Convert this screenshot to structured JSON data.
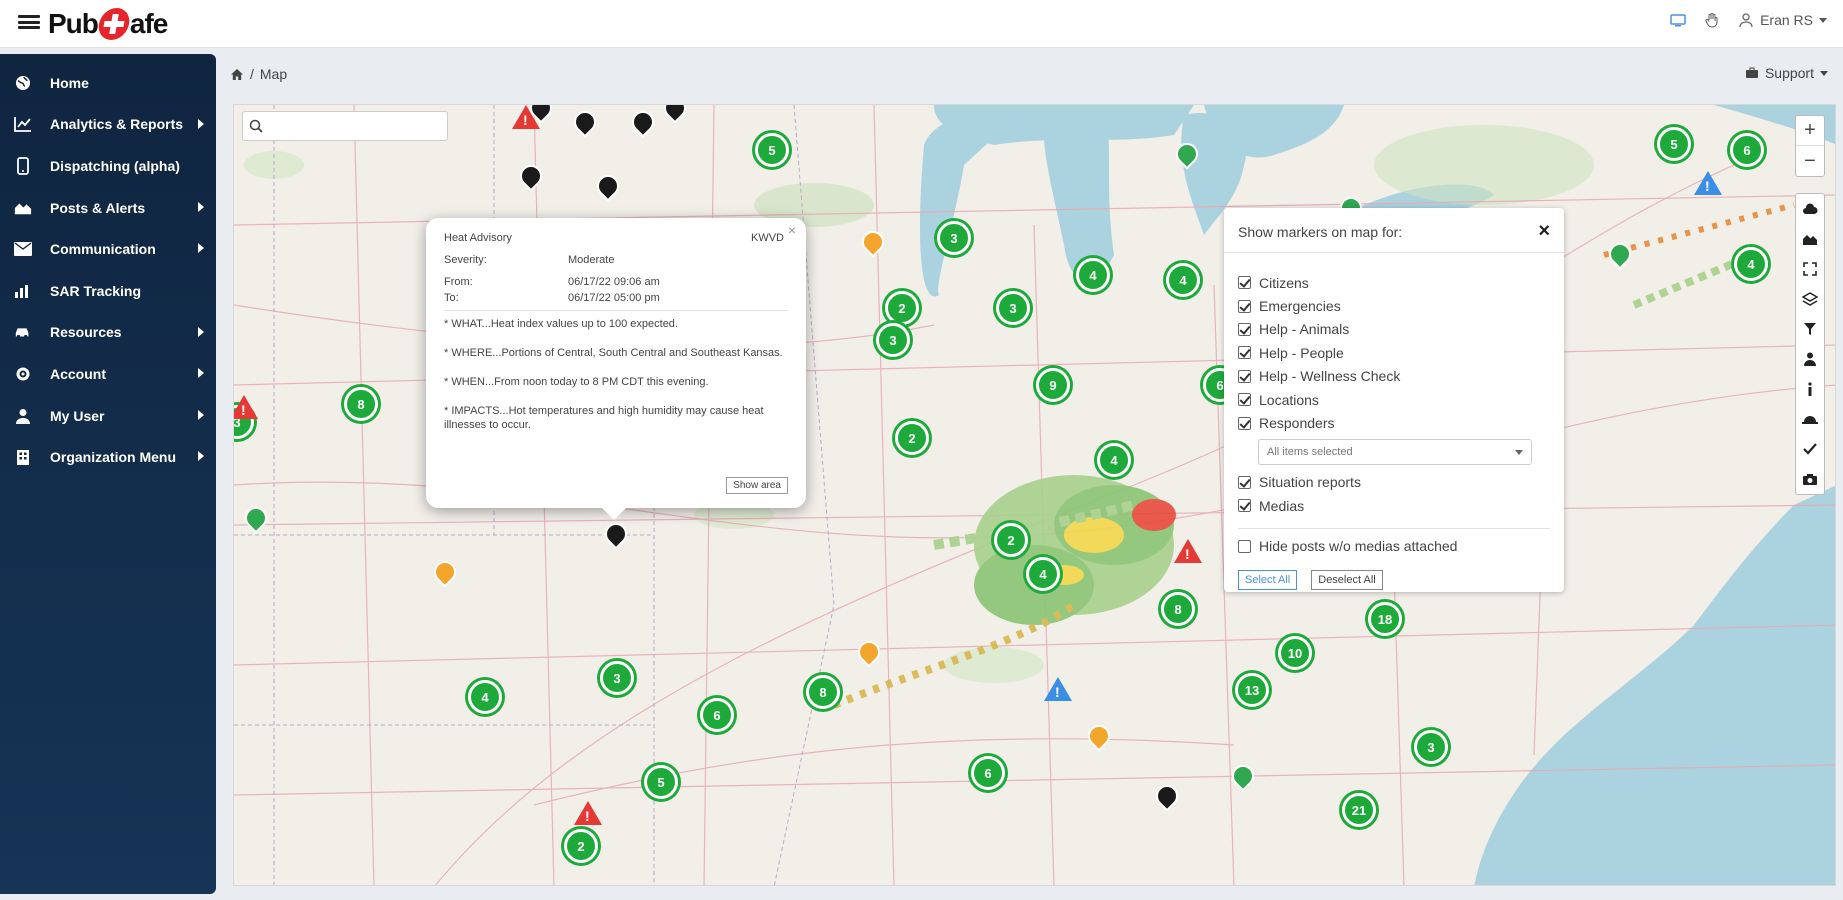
{
  "header": {
    "logo_left": "Pub",
    "logo_right": "afe",
    "user_name": "Eran RS"
  },
  "sidebar": {
    "items": [
      {
        "label": "Home",
        "icon": "globe-icon",
        "has_submenu": false
      },
      {
        "label": "Analytics & Reports",
        "icon": "chart-icon",
        "has_submenu": true
      },
      {
        "label": "Dispatching (alpha)",
        "icon": "phone-icon",
        "has_submenu": false
      },
      {
        "label": "Posts & Alerts",
        "icon": "houses-icon",
        "has_submenu": true
      },
      {
        "label": "Communication",
        "icon": "envelope-icon",
        "has_submenu": true
      },
      {
        "label": "SAR Tracking",
        "icon": "tracking-chart-icon",
        "has_submenu": false
      },
      {
        "label": "Resources",
        "icon": "cars-icon",
        "has_submenu": true
      },
      {
        "label": "Account",
        "icon": "gear-icon",
        "has_submenu": true
      },
      {
        "label": "My User",
        "icon": "user-icon",
        "has_submenu": true
      },
      {
        "label": "Organization Menu",
        "icon": "building-icon",
        "has_submenu": true
      }
    ]
  },
  "breadcrumb": {
    "separator": "/",
    "current": "Map"
  },
  "support": {
    "label": "Support"
  },
  "map": {
    "search_placeholder": "",
    "zoom_in": "+",
    "zoom_out": "−",
    "clusters": [
      {
        "label": "5"
      },
      {
        "label": "3"
      },
      {
        "label": "5"
      },
      {
        "label": "6"
      },
      {
        "label": "4"
      },
      {
        "label": "4"
      },
      {
        "label": "2"
      },
      {
        "label": "3"
      },
      {
        "label": "3"
      },
      {
        "label": "4"
      },
      {
        "label": "2"
      },
      {
        "label": "3"
      },
      {
        "label": "12"
      },
      {
        "label": "9"
      },
      {
        "label": "6"
      },
      {
        "label": "8"
      },
      {
        "label": "3"
      },
      {
        "label": "2"
      },
      {
        "label": "4"
      },
      {
        "label": "3"
      },
      {
        "label": "3"
      },
      {
        "label": "2"
      },
      {
        "label": "4"
      },
      {
        "label": "8"
      },
      {
        "label": "10"
      },
      {
        "label": "18"
      },
      {
        "label": "13"
      },
      {
        "label": "3"
      },
      {
        "label": "4"
      },
      {
        "label": "3"
      },
      {
        "label": "6"
      },
      {
        "label": "8"
      },
      {
        "label": "5"
      },
      {
        "label": "21"
      },
      {
        "label": "6"
      },
      {
        "label": "2"
      }
    ]
  },
  "popup": {
    "title": "Heat Advisory",
    "code": "KWVD",
    "severity_label": "Severity:",
    "severity_value": "Moderate",
    "from_label": "From:",
    "from_value": "06/17/22 09:06 am",
    "to_label": "To:",
    "to_value": "06/17/22 05:00 pm",
    "what": "* WHAT...Heat index values up to 100 expected.",
    "where": "* WHERE...Portions of Central, South Central and Southeast Kansas.",
    "when": "* WHEN...From noon today to 8 PM CDT this evening.",
    "impacts": "* IMPACTS...Hot temperatures and high humidity may cause heat illnesses to occur.",
    "show_area": "Show area"
  },
  "markers_panel": {
    "title": "Show markers on map for:",
    "options": [
      {
        "label": "Citizens",
        "checked": true
      },
      {
        "label": "Emergencies",
        "checked": true
      },
      {
        "label": "Help - Animals",
        "checked": true
      },
      {
        "label": "Help - People",
        "checked": true
      },
      {
        "label": "Help - Wellness Check",
        "checked": true
      },
      {
        "label": "Locations",
        "checked": true
      },
      {
        "label": "Responders",
        "checked": true
      }
    ],
    "responders_select": "All items selected",
    "options2": [
      {
        "label": "Situation reports",
        "checked": true
      },
      {
        "label": "Medias",
        "checked": true
      }
    ],
    "hide_posts_label": "Hide posts w/o medias attached",
    "hide_posts_checked": false,
    "select_all": "Select All",
    "deselect_all": "Deselect All"
  },
  "colors": {
    "sidebar_bg": "#0f2540",
    "cluster_green": "#1eaa3a",
    "warning_red": "#e53935",
    "water": "#aad3df",
    "land": "#f2efe9"
  }
}
